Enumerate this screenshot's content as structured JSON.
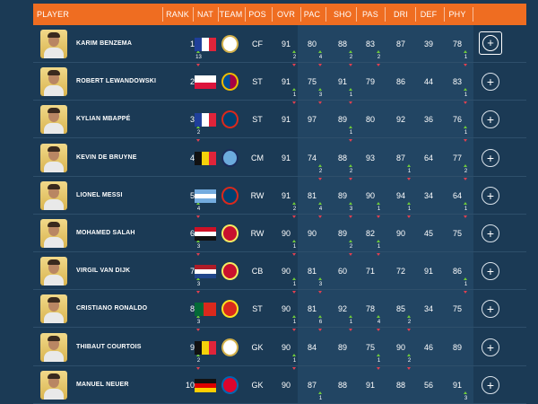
{
  "columns": {
    "player": "PLAYER",
    "rank": "RANK",
    "nat": "NAT",
    "team": "TEAM",
    "pos": "POS",
    "ovr": "OVR",
    "pac": "PAC",
    "sho": "SHO",
    "pas": "PAS",
    "dri": "DRI",
    "def": "DEF",
    "phy": "PHY"
  },
  "colors": {
    "header": "#ef6d21",
    "background": "#1b3a55",
    "boost_up": "#6fcb3a",
    "boost_down": "#e04050"
  },
  "players": [
    {
      "name": "KARIM BENZEMA",
      "rank": "1",
      "rank_boost": "13",
      "nation": "france-flag",
      "club": "real-madrid-badge",
      "pos": "CF",
      "ovr": "91",
      "ovr_boost": "2",
      "stats": {
        "pac": {
          "v": "80",
          "b": "4"
        },
        "sho": {
          "v": "88",
          "b": "2"
        },
        "pas": {
          "v": "83",
          "b": "2"
        },
        "dri": {
          "v": "87",
          "b": ""
        },
        "def": {
          "v": "39",
          "b": ""
        },
        "phy": {
          "v": "78",
          "b": "1"
        }
      },
      "selected": true
    },
    {
      "name": "ROBERT LEWANDOWSKI",
      "rank": "2",
      "rank_boost": "",
      "nation": "poland-flag",
      "club": "barcelona-badge",
      "pos": "ST",
      "ovr": "91",
      "ovr_boost": "1",
      "stats": {
        "pac": {
          "v": "75",
          "b": "3"
        },
        "sho": {
          "v": "91",
          "b": "1"
        },
        "pas": {
          "v": "79",
          "b": ""
        },
        "dri": {
          "v": "86",
          "b": ""
        },
        "def": {
          "v": "44",
          "b": ""
        },
        "phy": {
          "v": "83",
          "b": "1"
        }
      },
      "selected": false
    },
    {
      "name": "KYLIAN MBAPPÉ",
      "rank": "3",
      "rank_boost": "2",
      "nation": "france-flag",
      "club": "psg-badge",
      "pos": "ST",
      "ovr": "91",
      "ovr_boost": "",
      "stats": {
        "pac": {
          "v": "97",
          "b": ""
        },
        "sho": {
          "v": "89",
          "b": "1"
        },
        "pas": {
          "v": "80",
          "b": ""
        },
        "dri": {
          "v": "92",
          "b": ""
        },
        "def": {
          "v": "36",
          "b": ""
        },
        "phy": {
          "v": "76",
          "b": "1"
        }
      },
      "selected": false
    },
    {
      "name": "KEVIN DE BRUYNE",
      "rank": "4",
      "rank_boost": "",
      "nation": "belgium-flag",
      "club": "man-city-badge",
      "pos": "CM",
      "ovr": "91",
      "ovr_boost": "",
      "stats": {
        "pac": {
          "v": "74",
          "b": "2"
        },
        "sho": {
          "v": "88",
          "b": "2"
        },
        "pas": {
          "v": "93",
          "b": ""
        },
        "dri": {
          "v": "87",
          "b": "1"
        },
        "def": {
          "v": "64",
          "b": ""
        },
        "phy": {
          "v": "77",
          "b": "2"
        }
      },
      "selected": false
    },
    {
      "name": "LIONEL MESSI",
      "rank": "5",
      "rank_boost": "4",
      "nation": "argentina-flag",
      "club": "psg-badge",
      "pos": "RW",
      "ovr": "91",
      "ovr_boost": "2",
      "stats": {
        "pac": {
          "v": "81",
          "b": "4"
        },
        "sho": {
          "v": "89",
          "b": "3"
        },
        "pas": {
          "v": "90",
          "b": "1"
        },
        "dri": {
          "v": "94",
          "b": "1"
        },
        "def": {
          "v": "34",
          "b": ""
        },
        "phy": {
          "v": "64",
          "b": "1"
        }
      },
      "selected": false
    },
    {
      "name": "MOHAMED SALAH",
      "rank": "6",
      "rank_boost": "3",
      "nation": "egypt-flag",
      "club": "liverpool-badge",
      "pos": "RW",
      "ovr": "90",
      "ovr_boost": "1",
      "stats": {
        "pac": {
          "v": "90",
          "b": ""
        },
        "sho": {
          "v": "89",
          "b": "2"
        },
        "pas": {
          "v": "82",
          "b": "1"
        },
        "dri": {
          "v": "90",
          "b": ""
        },
        "def": {
          "v": "45",
          "b": ""
        },
        "phy": {
          "v": "75",
          "b": ""
        }
      },
      "selected": false
    },
    {
      "name": "VIRGIL VAN DIJK",
      "rank": "7",
      "rank_boost": "3",
      "nation": "netherlands-flag",
      "club": "liverpool-badge",
      "pos": "CB",
      "ovr": "90",
      "ovr_boost": "1",
      "stats": {
        "pac": {
          "v": "81",
          "b": "3"
        },
        "sho": {
          "v": "60",
          "b": ""
        },
        "pas": {
          "v": "71",
          "b": ""
        },
        "dri": {
          "v": "72",
          "b": ""
        },
        "def": {
          "v": "91",
          "b": ""
        },
        "phy": {
          "v": "86",
          "b": "1"
        }
      },
      "selected": false
    },
    {
      "name": "CRISTIANO RONALDO",
      "rank": "8",
      "rank_boost": "3",
      "nation": "portugal-flag",
      "club": "man-united-badge",
      "pos": "ST",
      "ovr": "90",
      "ovr_boost": "1",
      "stats": {
        "pac": {
          "v": "81",
          "b": "6"
        },
        "sho": {
          "v": "92",
          "b": "1"
        },
        "pas": {
          "v": "78",
          "b": "4"
        },
        "dri": {
          "v": "85",
          "b": "2"
        },
        "def": {
          "v": "34",
          "b": ""
        },
        "phy": {
          "v": "75",
          "b": ""
        }
      },
      "selected": false
    },
    {
      "name": "THIBAUT COURTOIS",
      "rank": "9",
      "rank_boost": "2",
      "nation": "belgium-flag",
      "club": "real-madrid-badge",
      "pos": "GK",
      "ovr": "90",
      "ovr_boost": "1",
      "stats": {
        "pac": {
          "v": "84",
          "b": ""
        },
        "sho": {
          "v": "89",
          "b": ""
        },
        "pas": {
          "v": "75",
          "b": "1"
        },
        "dri": {
          "v": "90",
          "b": "2"
        },
        "def": {
          "v": "46",
          "b": ""
        },
        "phy": {
          "v": "89",
          "b": ""
        }
      },
      "selected": false
    },
    {
      "name": "MANUEL NEUER",
      "rank": "10",
      "rank_boost": "",
      "nation": "germany-flag",
      "club": "bayern-badge",
      "pos": "GK",
      "ovr": "90",
      "ovr_boost": "",
      "stats": {
        "pac": {
          "v": "87",
          "b": "1"
        },
        "sho": {
          "v": "88",
          "b": ""
        },
        "pas": {
          "v": "91",
          "b": ""
        },
        "dri": {
          "v": "88",
          "b": ""
        },
        "def": {
          "v": "56",
          "b": ""
        },
        "phy": {
          "v": "91",
          "b": "3"
        }
      },
      "selected": false
    }
  ],
  "add_button": "+"
}
